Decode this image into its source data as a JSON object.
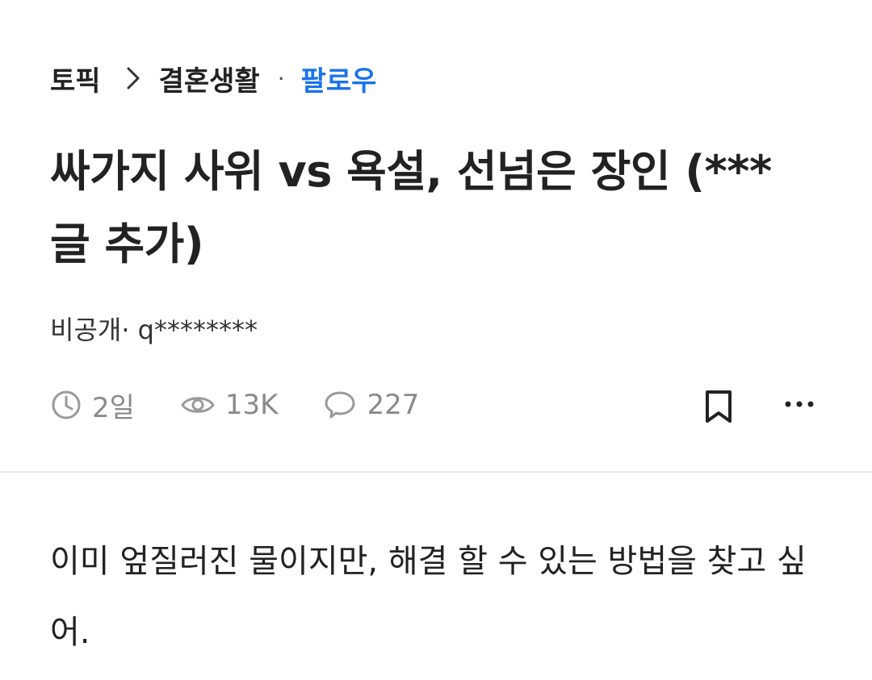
{
  "breadcrumb": {
    "root": "토픽",
    "category": "결혼생활",
    "separator": "·",
    "follow_label": "팔로우"
  },
  "post": {
    "title": "싸가지 사위 vs 욕설, 선넘은 장인 (*** 글 추가)",
    "author": "비공개· q********",
    "time": "2일",
    "views": "13K",
    "comments": "227",
    "body": "이미 엎질러진 물이지만, 해결 할 수 있는 방법을 찾고 싶어."
  },
  "colors": {
    "accent": "#1a73e8",
    "text": "#222222",
    "meta": "#8a8a8a",
    "divider": "#e6e6e6"
  },
  "icons": {
    "breadcrumb_sep": "chevron-right-icon",
    "time": "clock-icon",
    "views": "eye-icon",
    "comments": "speech-bubble-icon",
    "bookmark": "bookmark-icon",
    "more": "more-horizontal-icon"
  }
}
